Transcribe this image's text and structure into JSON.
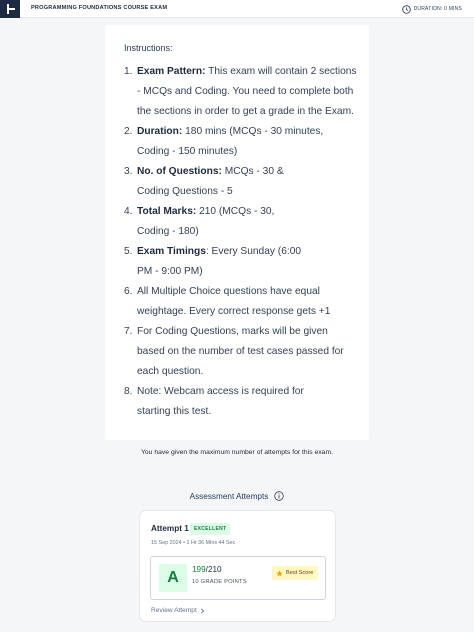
{
  "header": {
    "course_title": "PROGRAMMING FOUNDATIONS COURSE EXAM",
    "duration": "DURATION: 0 MINS"
  },
  "instructions": {
    "heading": "Instructions:",
    "items": [
      {
        "num": "1.",
        "bold": "Exam Pattern:",
        "line1": " This exam will contain 2 sections",
        "line2": "- MCQs and Coding. You need to complete both",
        "line3": "the sections in order to get a grade in the Exam."
      },
      {
        "num": "2.",
        "bold": "Duration:",
        "line1": " 180 mins (MCQs - 30 minutes,",
        "line2": "Coding - 150 minutes)"
      },
      {
        "num": "3.",
        "bold": "No. of Questions:",
        "line1": " MCQs - 30 &",
        "line2": "Coding Questions - 5"
      },
      {
        "num": "4.",
        "bold": "Total Marks:",
        "line1": " 210 (MCQs - 30,",
        "line2": "Coding - 180)"
      },
      {
        "num": "5.",
        "bold": "Exam Timings",
        "line1": ": Every Sunday (6:00",
        "line2": "PM - 9:00 PM)"
      },
      {
        "num": "6.",
        "line1": "All Multiple Choice questions have equal",
        "line2": "weightage. Every correct response gets +1"
      },
      {
        "num": "7.",
        "line1": "For Coding Questions, marks will be given",
        "line2": "based on the number of test cases passed for",
        "line3": "each question."
      },
      {
        "num": "8.",
        "line1": "Note: Webcam access is required for",
        "line2": "starting this test."
      }
    ]
  },
  "max_attempts_text": "You have given the maximum number of attempts for this exam.",
  "assessment": {
    "title": "Assessment Attempts",
    "attempt": {
      "name": "Attempt 1",
      "badge": "EXCELLENT",
      "meta": "15 Sep 2024  •  1 Hr 36 Mins 44 Sec",
      "grade": "A",
      "score_got": "199",
      "score_total": "/210",
      "grade_points": "10 GRADE POINTS",
      "best_label": "Best Score",
      "review_label": "Review Attempt"
    }
  },
  "colors": {
    "accent_green": "#15803d",
    "badge_bg": "#dcfce7",
    "best_bg": "#fef9c3",
    "logo_bg": "#1e2a44"
  }
}
